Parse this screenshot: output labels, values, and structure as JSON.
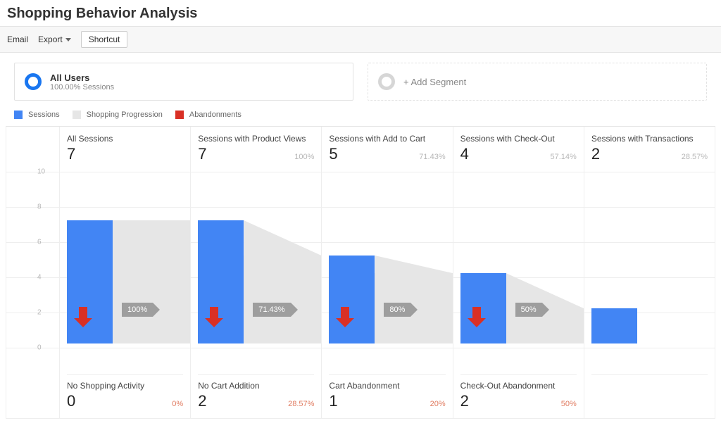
{
  "title": "Shopping Behavior Analysis",
  "toolbar": {
    "email": "Email",
    "export": "Export",
    "shortcut": "Shortcut"
  },
  "segments": {
    "primary": {
      "title": "All Users",
      "sub": "100.00% Sessions"
    },
    "add_label": "+ Add Segment"
  },
  "legend": {
    "sessions": "Sessions",
    "progression": "Shopping Progression",
    "abandonments": "Abandonments"
  },
  "axis": {
    "max": 10,
    "ticks": [
      0,
      2,
      4,
      6,
      8,
      10
    ]
  },
  "stages": [
    {
      "label": "All Sessions",
      "value": "7",
      "pct": "",
      "flow_pct": "100%"
    },
    {
      "label": "Sessions with Product Views",
      "value": "7",
      "pct": "100%",
      "flow_pct": "71.43%"
    },
    {
      "label": "Sessions with Add to Cart",
      "value": "5",
      "pct": "71.43%",
      "flow_pct": "80%"
    },
    {
      "label": "Sessions with Check-Out",
      "value": "4",
      "pct": "57.14%",
      "flow_pct": "50%"
    },
    {
      "label": "Sessions with Transactions",
      "value": "2",
      "pct": "28.57%",
      "flow_pct": ""
    }
  ],
  "abandonments": [
    {
      "label": "No Shopping Activity",
      "value": "0",
      "pct": "0%"
    },
    {
      "label": "No Cart Addition",
      "value": "2",
      "pct": "28.57%"
    },
    {
      "label": "Cart Abandonment",
      "value": "1",
      "pct": "20%"
    },
    {
      "label": "Check-Out Abandonment",
      "value": "2",
      "pct": "50%"
    }
  ],
  "chart_data": {
    "type": "bar",
    "title": "Shopping Behavior Analysis",
    "ylabel": "Sessions",
    "ylim": [
      0,
      10
    ],
    "categories": [
      "All Sessions",
      "Sessions with Product Views",
      "Sessions with Add to Cart",
      "Sessions with Check-Out",
      "Sessions with Transactions"
    ],
    "series": [
      {
        "name": "Sessions",
        "values": [
          7,
          7,
          5,
          4,
          2
        ]
      },
      {
        "name": "Progression % (to next)",
        "values": [
          100,
          71.43,
          80,
          50,
          null
        ]
      },
      {
        "name": "Abandonments",
        "values": [
          0,
          2,
          1,
          2,
          null
        ]
      },
      {
        "name": "Abandonment %",
        "values": [
          0,
          28.57,
          20,
          50,
          null
        ]
      }
    ],
    "stage_pct_of_total": [
      null,
      100,
      71.43,
      57.14,
      28.57
    ],
    "abandonment_labels": [
      "No Shopping Activity",
      "No Cart Addition",
      "Cart Abandonment",
      "Check-Out Abandonment"
    ]
  }
}
